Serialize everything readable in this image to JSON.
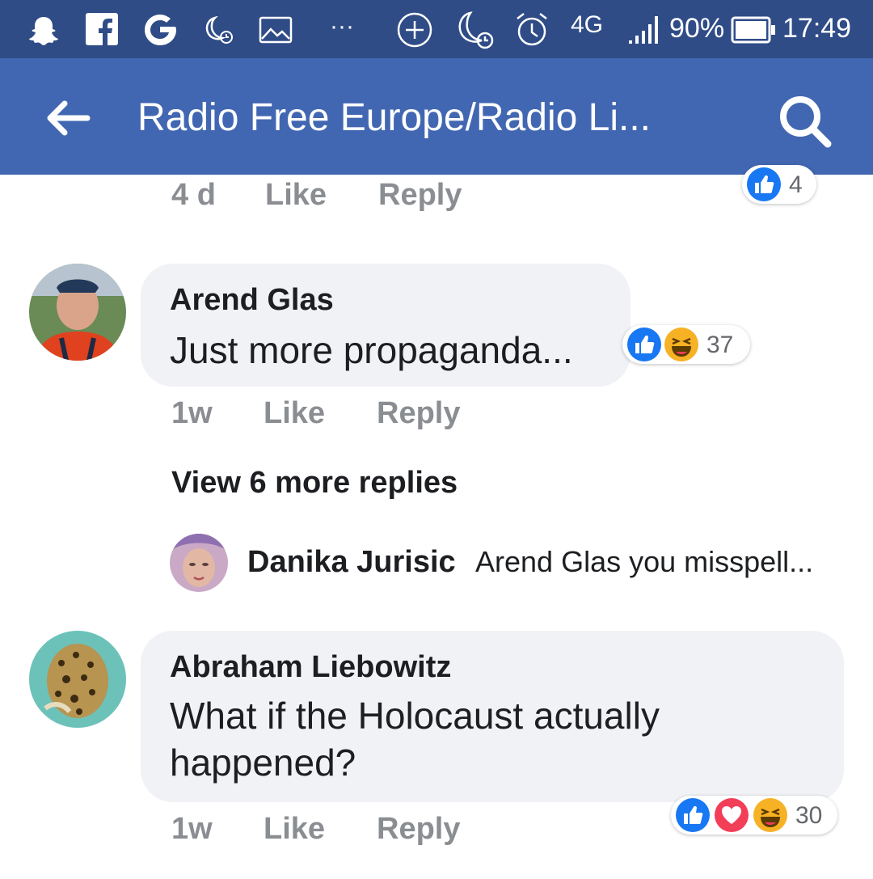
{
  "status_bar": {
    "icons": [
      "snapchat-icon",
      "facebook-icon",
      "google-icon",
      "night-alarm-icon",
      "image-icon",
      "more-icon",
      "add-circle-icon",
      "moon-alarm-icon",
      "alarm-icon",
      "signal-icon",
      "battery-icon"
    ],
    "more": "···",
    "network": "4G",
    "battery": "90%",
    "time": "17:49"
  },
  "app_bar": {
    "title": "Radio Free Europe/Radio Li...",
    "back_icon": "arrow-left-icon",
    "search_icon": "search-icon"
  },
  "comments": [
    {
      "time": "4 d",
      "like_label": "Like",
      "reply_label": "Reply",
      "reactions": [
        "like"
      ],
      "reaction_count": "4"
    },
    {
      "author": "Arend Glas",
      "text": "Just more propaganda...",
      "time": "1w",
      "like_label": "Like",
      "reply_label": "Reply",
      "reactions": [
        "like",
        "haha"
      ],
      "reaction_count": "37"
    },
    {
      "author": "Abraham Liebowitz",
      "text": "What if the Holocaust actually happened?",
      "time": "1w",
      "like_label": "Like",
      "reply_label": "Reply",
      "reactions": [
        "like",
        "love",
        "haha"
      ],
      "reaction_count": "30"
    }
  ],
  "replies": {
    "view_more": "View 6 more replies",
    "preview": {
      "author": "Danika Jurisic",
      "text": "Arend Glas you misspell..."
    }
  },
  "colors": {
    "status_bar": "#2f4c87",
    "app_bar": "#4267b2",
    "bubble": "#f0f2f5",
    "like_blue": "#1877f2",
    "love_red": "#f33e58",
    "haha_yellow": "#f7b125"
  }
}
